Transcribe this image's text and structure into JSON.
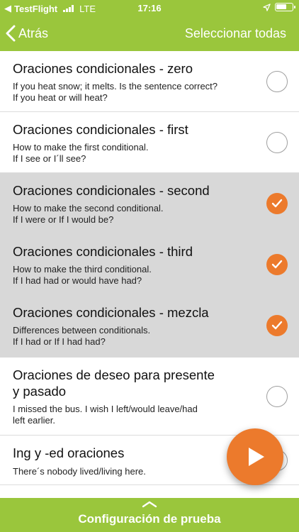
{
  "status_bar": {
    "app": "TestFlight",
    "carrier": "LTE",
    "time": "17:16"
  },
  "nav": {
    "back_label": "Atrás",
    "select_all_label": "Seleccionar todas"
  },
  "items": [
    {
      "title": "Oraciones condicionales - zero",
      "sub1": "If you heat snow; it melts. Is the sentence correct?",
      "sub2": "If you heat or will heat?",
      "selected": false
    },
    {
      "title": "Oraciones condicionales - first",
      "sub1": "How to make the first conditional.",
      "sub2": "If I see or I´ll see?",
      "selected": false
    },
    {
      "title": "Oraciones condicionales - second",
      "sub1": "How to make the second conditional.",
      "sub2": "If I were or If I would be?",
      "selected": true
    },
    {
      "title": "Oraciones condicionales - third",
      "sub1": "How to make the third conditional.",
      "sub2": "If I had had or would have had?",
      "selected": true
    },
    {
      "title": "Oraciones condicionales - mezcla",
      "sub1": "Differences between conditionals.",
      "sub2": "If I had or If I had had?",
      "selected": true
    },
    {
      "title1": "Oraciones de deseo para presente",
      "title2": "y pasado",
      "sub1": "I missed the bus. I wish I left/would leave/had",
      "sub2": "left earlier.",
      "selected": false
    },
    {
      "title": "Ing y -ed oraciones",
      "sub1": "There´s nobody lived/living here.",
      "selected": false
    }
  ],
  "bottom_bar": {
    "label": "Configuración de prueba"
  },
  "colors": {
    "accent": "#9ac63c",
    "selected_check": "#ec7a2c",
    "selected_row": "#d8d8d8"
  }
}
